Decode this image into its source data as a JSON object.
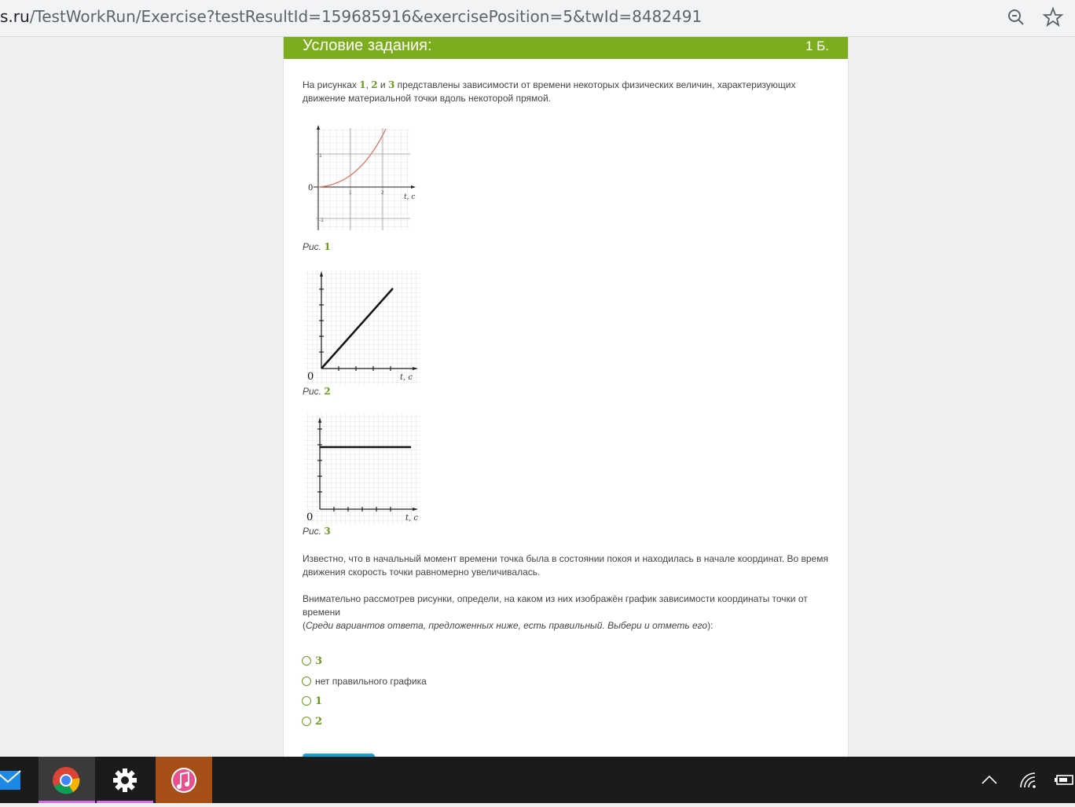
{
  "browser": {
    "url_host": "s.ru",
    "url_path": "/TestWorkRun/Exercise?testResultId=159685916&exercisePosition=5&twId=8482491",
    "zoom_icon": "zoom-icon",
    "star_icon": "star-icon"
  },
  "exercise": {
    "title": "Условие задания:",
    "score": "1 Б.",
    "intro_a": "На рисунках ",
    "n1": "1",
    "comma": ", ",
    "n2": "2",
    "and": " и ",
    "n3": "3",
    "intro_b": " представлены зависимости от времени некоторых физических величин, характеризующих движение материальной точки вдоль некоторой прямой.",
    "figures": [
      {
        "caption_prefix": "Рис. ",
        "caption_num": "1",
        "origin": "0",
        "axis_label": "t, с",
        "tick1": "1",
        "tick2": "2",
        "ytick": "1",
        "ytick_neg": "-1"
      },
      {
        "caption_prefix": "Рис. ",
        "caption_num": "2",
        "origin": "0",
        "axis_label": "t, с"
      },
      {
        "caption_prefix": "Рис. ",
        "caption_num": "3",
        "origin": "0",
        "axis_label": "t, с"
      }
    ],
    "known": "Известно, что в начальный момент времени точка была в состоянии покоя и находилась в начале координат. Во время движения скорость точки равномерно увеличивалась.",
    "question": "Внимательно рассмотрев рисунки, определи, на каком из них изображён график зависимости координаты точки от времени",
    "hint_open": "(",
    "hint": "Среди вариантов ответа, предложенных ниже, есть правильный. Выбери и отметь его",
    "hint_close": "):",
    "options": [
      "3",
      "нет правильного графика",
      "1",
      "2"
    ]
  },
  "taskbar": {
    "apps": [
      "mail-icon",
      "chrome-icon",
      "settings-icon",
      "itunes-icon"
    ],
    "tray": [
      "chevron-up-icon",
      "wifi-icon",
      "battery-icon"
    ]
  },
  "colors": {
    "accent": "#7cad1f",
    "text_accent": "#6a9a1a",
    "button": "#1a9fd0"
  }
}
